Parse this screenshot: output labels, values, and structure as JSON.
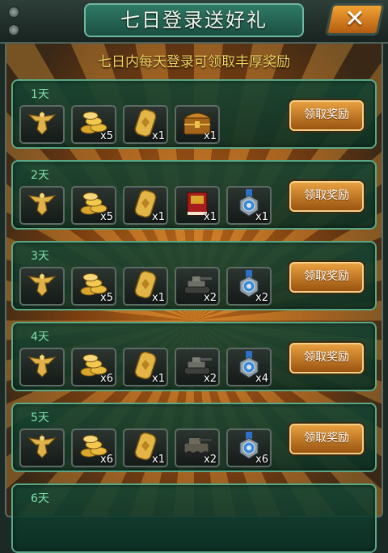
{
  "title": "七日登录送好礼",
  "subtitle": "七日内每天登录可领取丰厚奖励",
  "close_symbol": "✕",
  "claim_label": "领取奖励",
  "colors": {
    "accent": "#f4d35e",
    "panel_border": "#58a886",
    "button": "#e7a040"
  },
  "days": [
    {
      "label": "1天",
      "items": [
        {
          "icon": "eagle-badge-icon",
          "qty": ""
        },
        {
          "icon": "gold-coins-icon",
          "qty": "x5"
        },
        {
          "icon": "eagle-token-icon",
          "qty": "x1"
        },
        {
          "icon": "treasure-chest-icon",
          "qty": "x1"
        }
      ]
    },
    {
      "label": "2天",
      "items": [
        {
          "icon": "eagle-badge-icon",
          "qty": ""
        },
        {
          "icon": "gold-coins-icon",
          "qty": "x5"
        },
        {
          "icon": "eagle-token-icon",
          "qty": "x1"
        },
        {
          "icon": "red-book-icon",
          "qty": "x1"
        },
        {
          "icon": "medal-icon",
          "qty": "x1"
        }
      ]
    },
    {
      "label": "3天",
      "items": [
        {
          "icon": "eagle-badge-icon",
          "qty": ""
        },
        {
          "icon": "gold-coins-icon",
          "qty": "x5"
        },
        {
          "icon": "eagle-token-icon",
          "qty": "x1"
        },
        {
          "icon": "tank-icon",
          "qty": "x2"
        },
        {
          "icon": "medal-icon",
          "qty": "x2"
        }
      ]
    },
    {
      "label": "4天",
      "items": [
        {
          "icon": "eagle-badge-icon",
          "qty": ""
        },
        {
          "icon": "gold-coins-icon",
          "qty": "x6"
        },
        {
          "icon": "eagle-token-icon",
          "qty": "x1"
        },
        {
          "icon": "tank-icon",
          "qty": "x2"
        },
        {
          "icon": "medal-icon",
          "qty": "x4"
        }
      ]
    },
    {
      "label": "5天",
      "items": [
        {
          "icon": "eagle-badge-icon",
          "qty": ""
        },
        {
          "icon": "gold-coins-icon",
          "qty": "x6"
        },
        {
          "icon": "eagle-token-icon",
          "qty": "x1"
        },
        {
          "icon": "armored-vehicle-icon",
          "qty": "x2"
        },
        {
          "icon": "medal-icon",
          "qty": "x6"
        }
      ]
    },
    {
      "label": "6天",
      "items": []
    }
  ]
}
